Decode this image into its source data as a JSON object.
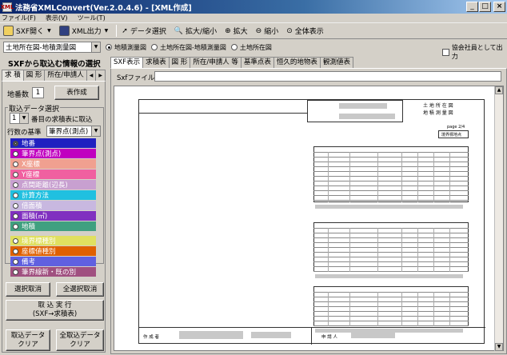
{
  "window": {
    "title": "法務省XMLConvert(Ver.2.0.4.6) - [XML作成]",
    "app_icon": "XML",
    "min": "_",
    "max": "□",
    "close": "×"
  },
  "menu": [
    "ファイル(F)",
    "表示(V)",
    "ツール(T)"
  ],
  "toolbar": {
    "open_sxf": "SXF開く",
    "xml_out": "XML出力",
    "data_select": "データ選択",
    "zoom_box": "拡大/縮小",
    "zoom_in": "拡大",
    "zoom_out": "縮小",
    "fit_all": "全体表示"
  },
  "row2": {
    "map_select": "土地所在図-地積測量図",
    "options": [
      "地積測量図",
      "土地所在図-地積測量図",
      "土地所在図"
    ],
    "selected": 0,
    "association": "協会社員として出力"
  },
  "left": {
    "title": "SXFから取込む情報の選択",
    "tabs": [
      "求 積",
      "図 形",
      "所在/申請人"
    ],
    "chiban_label": "地番数",
    "chiban_value": "1",
    "table_make": "表作成",
    "group_title": "取込データ選択",
    "row_num": "1",
    "row_suffix": "番目の求積表に取込",
    "row_basis_label": "行数の基準",
    "row_basis_value": "筆界点(測点)",
    "fields": [
      {
        "label": "地番",
        "color": "#2020c0",
        "selected": true
      },
      {
        "label": "筆界点(測点)",
        "color": "#c000c0",
        "selected": false
      },
      {
        "label": "X座標",
        "color": "#f0a090",
        "selected": false
      },
      {
        "label": "Y座標",
        "color": "#f060a0",
        "selected": false
      },
      {
        "label": "点間距離(辺長)",
        "color": "#c8a0d0",
        "selected": false
      },
      {
        "label": "計算方法",
        "color": "#20c0e0",
        "selected": false
      },
      {
        "label": "倍面積",
        "color": "#c8b8e0",
        "selected": false
      },
      {
        "label": "面積(㎡)",
        "color": "#8030c0",
        "selected": false
      },
      {
        "label": "地積",
        "color": "#40a080",
        "selected": false
      },
      {
        "label": "境界標種別",
        "color": "#e0e060",
        "selected": false
      },
      {
        "label": "座標値種別",
        "color": "#e06000",
        "selected": false
      },
      {
        "label": "備考",
        "color": "#6060e0",
        "selected": false
      },
      {
        "label": "筆界線新・既の別",
        "color": "#a05080",
        "selected": false
      }
    ],
    "btn_clear_sel": "選択取消",
    "btn_clear_all": "全選択取消",
    "btn_import": "取 込 実 行\n(SXF→求積表)",
    "btn_import_clear": "取込データ\nクリア",
    "btn_all_import_clear": "全取込データ\nクリア"
  },
  "right": {
    "tabs": [
      "SXF表示",
      "求積表",
      "図 形",
      "所在/申請人 等",
      "基準点表",
      "恒久的地物表",
      "観測値表"
    ],
    "sxf_label": "Sxfファイル",
    "sheet": {
      "header1": "土 地 所 在 図",
      "header2": "地 積 測 量 図",
      "page": "page 2/4",
      "stamp": "境界標地点",
      "foot_left": "作 成 者",
      "foot_right": "申 請 人"
    }
  }
}
